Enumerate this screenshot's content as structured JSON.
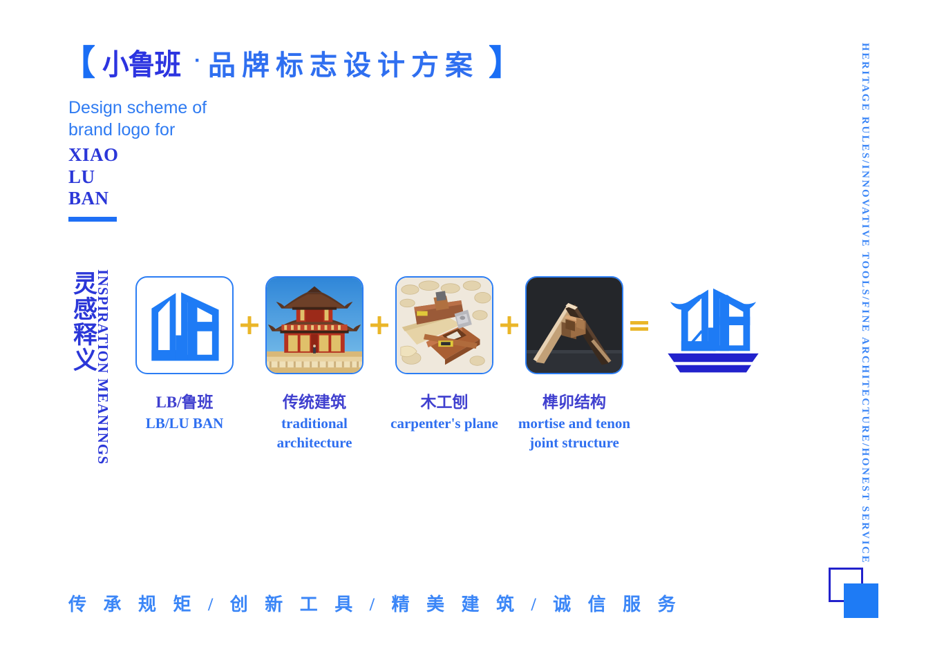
{
  "title": {
    "bracket_open": "【",
    "brand": "小鲁班",
    "separator": "·",
    "rest": "品牌标志设计方案",
    "bracket_close": "】"
  },
  "subtitle": {
    "line1": "Design scheme of",
    "line2": "brand logo for"
  },
  "brand_name": {
    "line1": "XIAO",
    "line2": "LU",
    "line3": "BAN"
  },
  "section_label": {
    "cn": "灵感释义",
    "en": "INSPIRATION MEANINGS"
  },
  "right_caption": "HERITAGE RULES/INNOVATIVE TOOLS/FINE ARCHITECTURE/HONEST SERVICE",
  "formula": {
    "items": [
      {
        "icon": "lb-monogram-logo",
        "cn": "LB/鲁班",
        "en_line1": "LB/LU BAN",
        "en_line2": ""
      },
      {
        "icon": "traditional-architecture-photo",
        "cn": "传统建筑",
        "en_line1": "traditional",
        "en_line2": "architecture"
      },
      {
        "icon": "carpenters-plane-photo",
        "cn": "木工刨",
        "en_line1": "carpenter's plane",
        "en_line2": ""
      },
      {
        "icon": "mortise-tenon-joint-photo",
        "cn": "榫卯结构",
        "en_line1": "mortise and tenon",
        "en_line2": "joint structure"
      }
    ],
    "operators": [
      "+",
      "+",
      "+",
      "="
    ],
    "result": {
      "icon": "final-luban-logo",
      "cn": "",
      "en_line1": ""
    }
  },
  "tagline": "传 承 规 矩 / 创 新 工 具 / 精 美 建 筑 / 诚 信 服 务",
  "colors": {
    "primary_blue": "#1e7bf5",
    "deep_blue": "#2222cc",
    "indigo": "#2b37d8",
    "accent_gold": "#eab629",
    "background": "#ffffff"
  }
}
